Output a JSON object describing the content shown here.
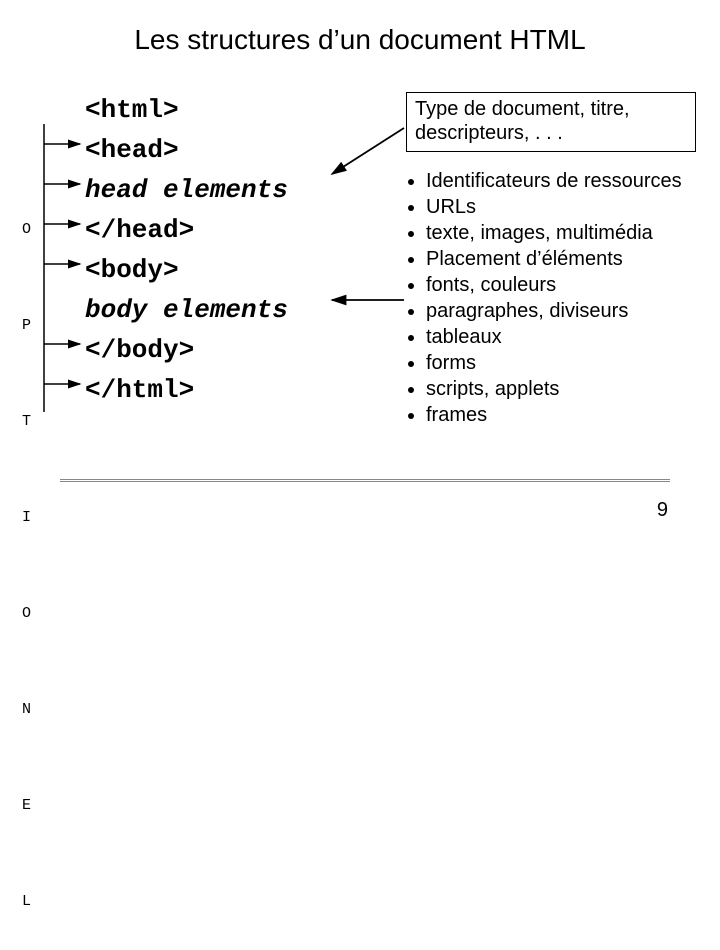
{
  "title": "Les structures d’un document HTML",
  "vertical_label": [
    "O",
    "P",
    "T",
    "I",
    "O",
    "N",
    "E",
    "L"
  ],
  "code": {
    "l0": "<html>",
    "l1": "<head>",
    "l2": "head elements",
    "l3": "</head>",
    "l4": "<body>",
    "l5": "body elements",
    "l6": "</body>",
    "l7": "</html>"
  },
  "annotation": "Type de document, titre, descripteurs, . . .",
  "bullets": [
    "Identificateurs de ressources",
    " URLs",
    "texte, images, multimédia",
    "Placement d’éléments",
    "fonts, couleurs",
    "paragraphes, diviseurs",
    "tableaux",
    "forms",
    "scripts, applets",
    "frames"
  ],
  "page_number": "9"
}
